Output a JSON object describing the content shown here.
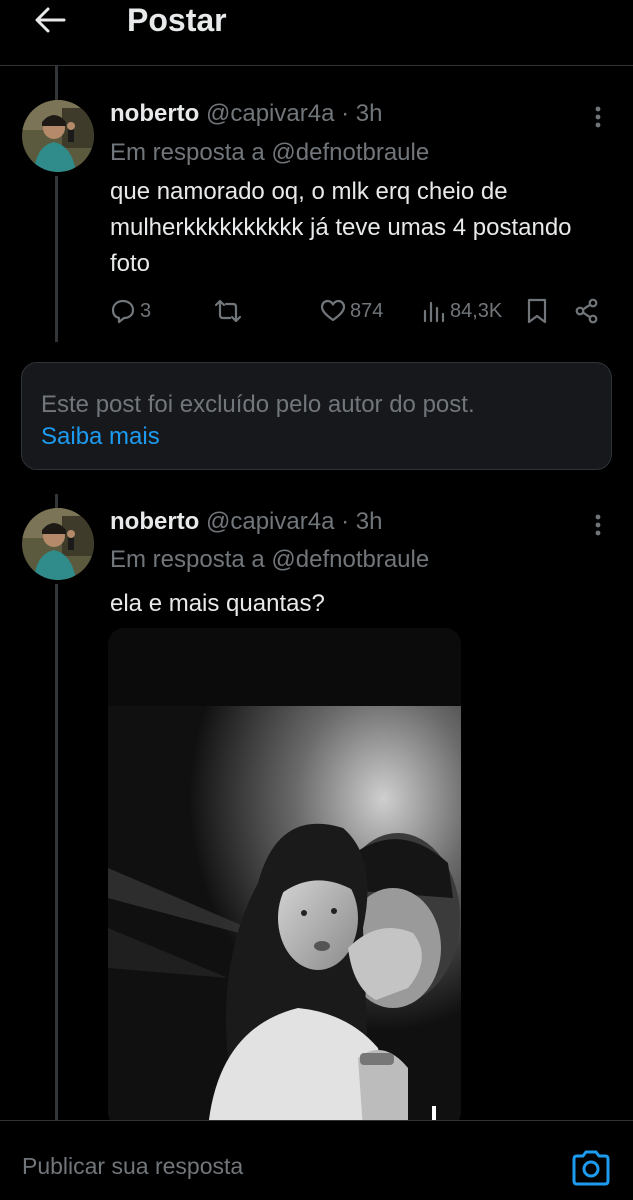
{
  "header": {
    "title": "Postar",
    "back_icon": "arrow-left-icon"
  },
  "posts": [
    {
      "name": "noberto",
      "handle": "@capivar4a",
      "dot": "·",
      "time": "3h",
      "reply_label": "Em resposta a @defnotbraule",
      "text": "que namorado oq, o mlk erq cheio de mulherkkkkkkkkkk já teve umas 4 postando foto",
      "actions": {
        "replies": "3",
        "likes": "874",
        "views": "84,3K"
      }
    },
    {
      "name": "noberto",
      "handle": "@capivar4a",
      "dot": "·",
      "time": "3h",
      "reply_label": "Em resposta a @defnotbraule",
      "text": "ela e mais quantas?"
    }
  ],
  "deleted_notice": {
    "text": "Este post foi excluído pelo autor do post.",
    "link": "Saiba mais"
  },
  "reply_bar": {
    "placeholder": "Publicar sua resposta"
  },
  "colors": {
    "background": "#000000",
    "text": "#e7e9ea",
    "muted": "#71767b",
    "link": "#1d9bf0",
    "border": "#2f3336"
  }
}
